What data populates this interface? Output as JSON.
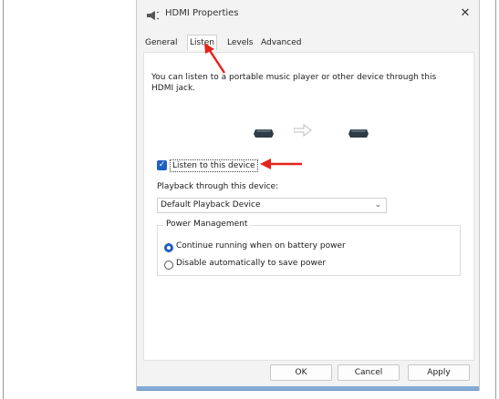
{
  "window": {
    "title": "HDMI Properties",
    "close_symbol": "✕"
  },
  "tabs": [
    {
      "label": "General",
      "active": false
    },
    {
      "label": "Listen",
      "active": true
    },
    {
      "label": "Levels",
      "active": false
    },
    {
      "label": "Advanced",
      "active": false
    }
  ],
  "listen": {
    "description": "You can listen to a portable music player or other device through this HDMI jack.",
    "checkbox_label": "Listen to this device",
    "checkbox_checked": true,
    "playback_label": "Playback through this device:",
    "playback_value": "Default Playback Device"
  },
  "power": {
    "legend": "Power Management",
    "options": [
      {
        "label": "Continue running when on battery power",
        "selected": true
      },
      {
        "label": "Disable automatically to save power",
        "selected": false
      }
    ]
  },
  "buttons": {
    "ok": "OK",
    "cancel": "Cancel",
    "apply": "Apply"
  },
  "colors": {
    "accent": "#1f5fbf",
    "annotation": "#e3241b"
  },
  "icons": [
    "speaker-icon",
    "hdmi-device-icon",
    "arrow-right-icon",
    "chevron-down-icon",
    "close-icon"
  ]
}
